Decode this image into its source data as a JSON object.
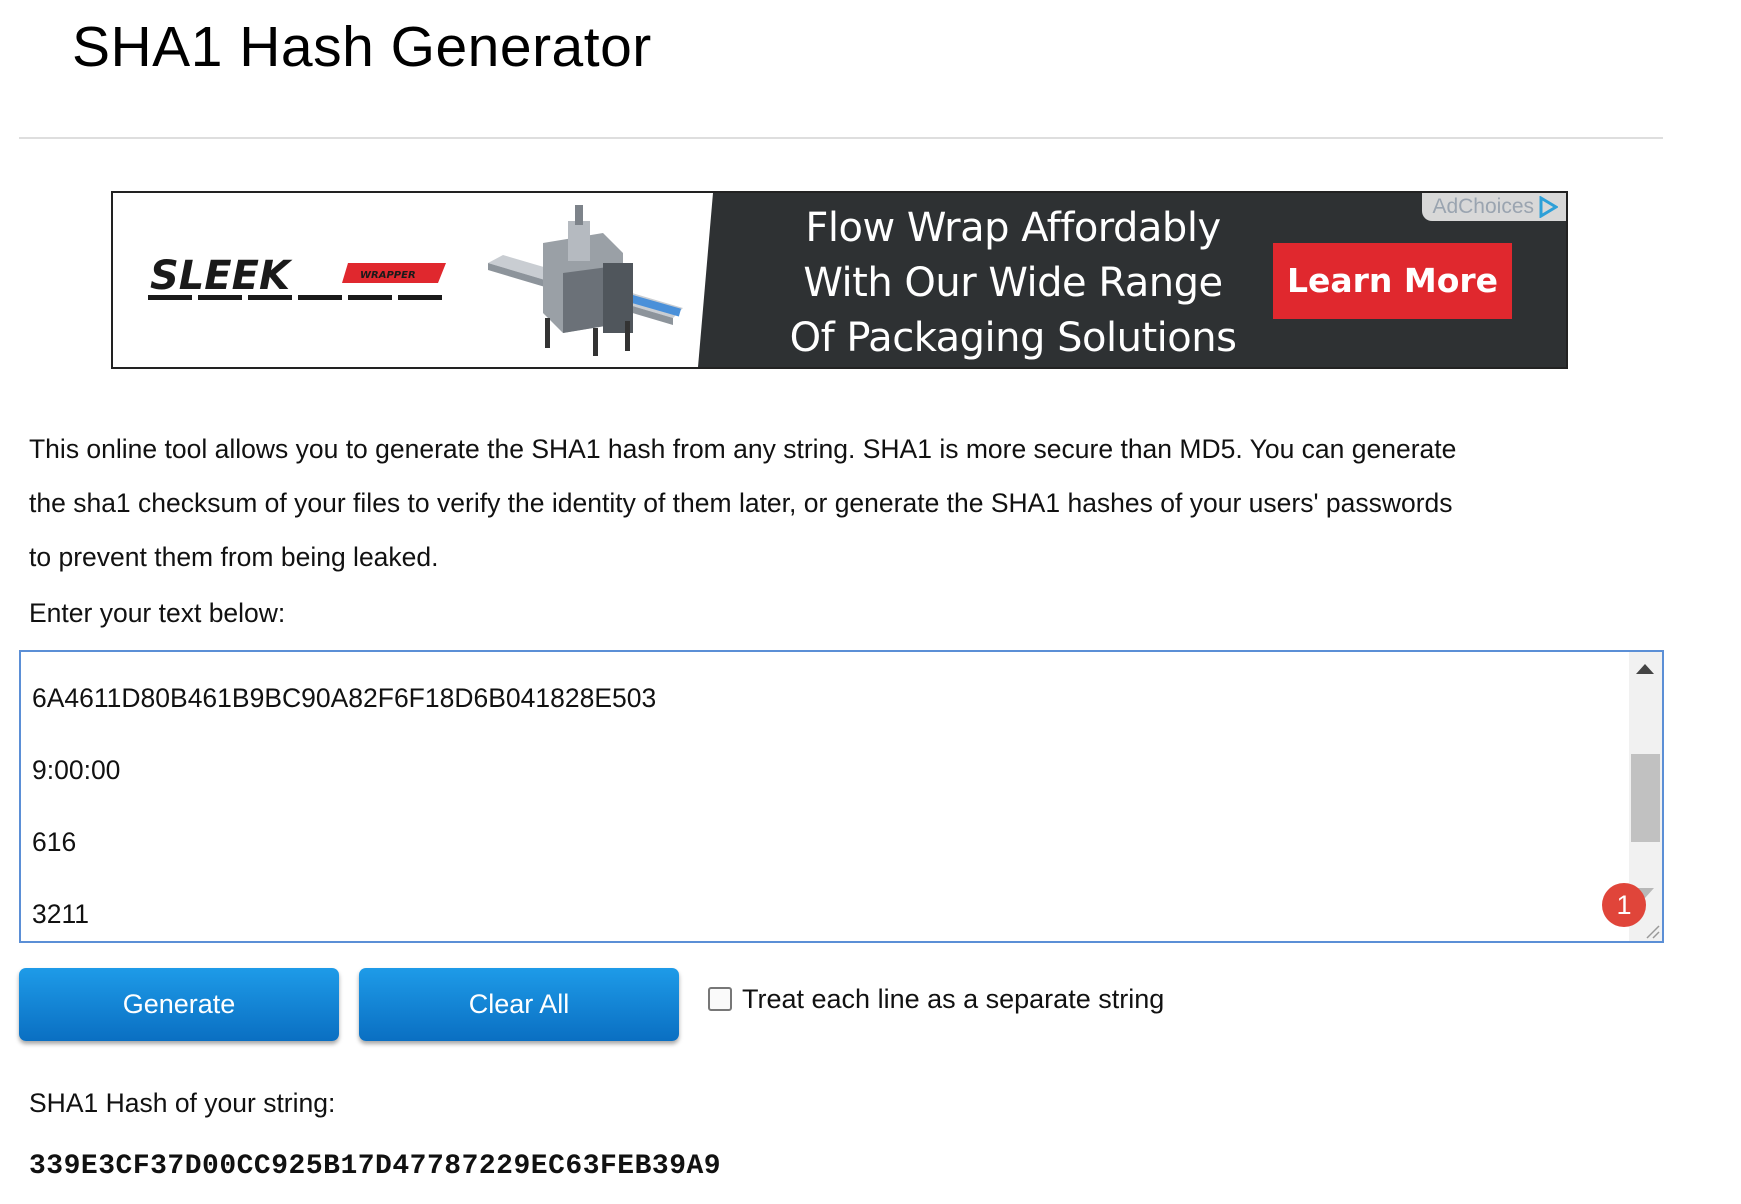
{
  "page": {
    "title": "SHA1 Hash Generator"
  },
  "ad": {
    "brand": "SLEEK",
    "brand_sub": "WRAPPER",
    "headline_lines": [
      "Flow Wrap Affordably",
      "With Our Wide Range",
      "Of Packaging Solutions"
    ],
    "cta_label": "Learn More",
    "adchoices_label": "AdChoices",
    "colors": {
      "background": "#2e3133",
      "cta": "#e0282e"
    }
  },
  "description": {
    "lines": [
      "This online tool allows you to generate the SHA1 hash from any string. SHA1 is more secure than MD5. You can generate",
      "the sha1 checksum of your files to verify the identity of them later, or generate the SHA1 hashes of your users' passwords",
      "to prevent them from being leaked."
    ],
    "prompt": "Enter your text below:"
  },
  "input": {
    "lines": [
      "6A4611D80B461B9BC90A82F6F18D6B041828E503",
      "9:00:00",
      "616",
      "3211"
    ],
    "badge_count": "1"
  },
  "actions": {
    "generate_label": "Generate",
    "clear_label": "Clear All",
    "separate_lines_label": "Treat each line as a separate string",
    "separate_lines_checked": false,
    "button_color": "#0a7fd6"
  },
  "result": {
    "label": "SHA1 Hash of your string:",
    "value": "339E3CF37D00CC925B17D47787229EC63FEB39A9"
  }
}
